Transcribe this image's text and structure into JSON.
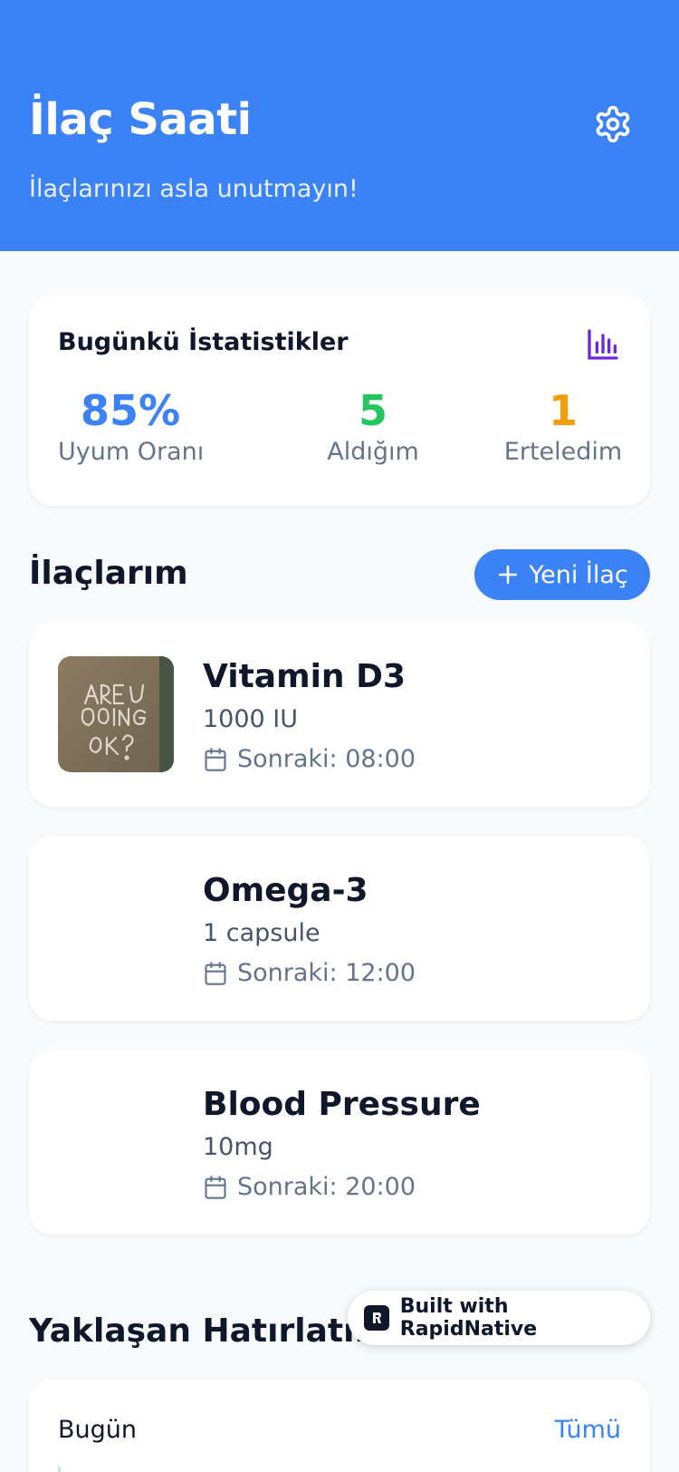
{
  "header": {
    "title": "İlaç Saati",
    "subtitle": "İlaçlarınızı asla unutmayın!",
    "settings_icon": "gear-icon"
  },
  "stats": {
    "title": "Bugünkü İstatistikler",
    "icon": "bar-chart-icon",
    "items": [
      {
        "value": "85%",
        "label": "Uyum Oranı",
        "color": "#3b82f6"
      },
      {
        "value": "5",
        "label": "Aldığım",
        "color": "#22c55e"
      },
      {
        "value": "1",
        "label": "Erteledim",
        "color": "#f59e0b"
      }
    ]
  },
  "medications": {
    "title": "İlaçlarım",
    "add_button": "Yeni İlaç",
    "items": [
      {
        "name": "Vitamin D3",
        "dose": "1000 IU",
        "next": "Sonraki: 08:00",
        "has_image": true
      },
      {
        "name": "Omega-3",
        "dose": "1 capsule",
        "next": "Sonraki: 12:00",
        "has_image": false
      },
      {
        "name": "Blood Pressure",
        "dose": "10mg",
        "next": "Sonraki: 20:00",
        "has_image": false
      }
    ]
  },
  "upcoming": {
    "title": "Yaklaşan Hatırlatmalar",
    "day": "Bugün",
    "view_all": "Tümü"
  },
  "badge": {
    "label": "Built with RapidNative"
  },
  "colors": {
    "primary": "#3b82f6",
    "success": "#22c55e",
    "warning": "#f59e0b",
    "chart_icon": "#6d28d9"
  }
}
